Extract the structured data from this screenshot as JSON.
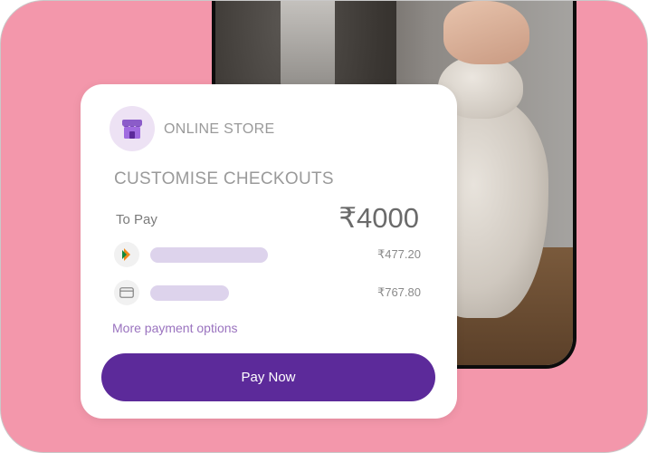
{
  "card": {
    "store_name": "ONLINE STORE",
    "section_title": "CUSTOMISE CHECKOUTS",
    "to_pay_label": "To Pay",
    "to_pay_amount": "₹4000",
    "payment_methods": [
      {
        "icon": "bhim-upi-icon",
        "amount": "₹477.20"
      },
      {
        "icon": "card-icon",
        "amount": "₹767.80"
      }
    ],
    "more_options_label": "More payment options",
    "pay_button_label": "Pay Now"
  },
  "colors": {
    "background": "#f397ab",
    "accent": "#5c2a9a",
    "store_icon_bg": "#ede2f4",
    "placeholder_bar": "#ddd3ec",
    "link": "#9a73bf"
  }
}
